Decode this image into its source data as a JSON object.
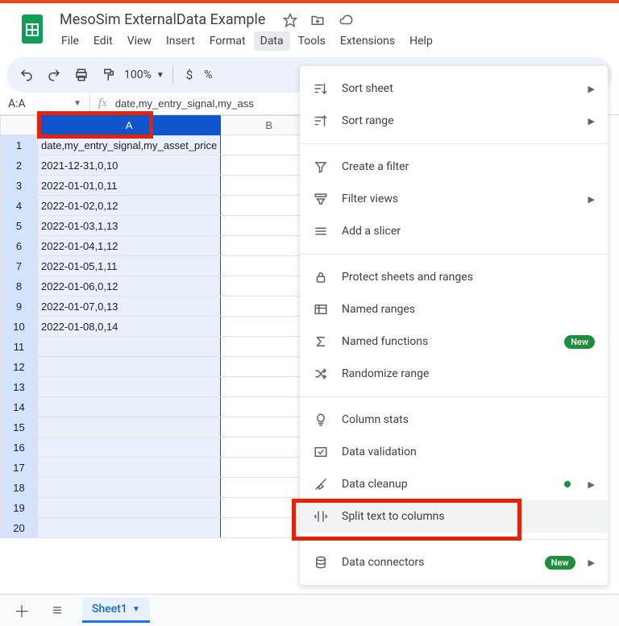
{
  "doc": {
    "title": "MesoSim ExternalData Example"
  },
  "menubar": [
    "File",
    "Edit",
    "View",
    "Insert",
    "Format",
    "Data",
    "Tools",
    "Extensions",
    "Help"
  ],
  "menubar_open_index": 5,
  "toolbar": {
    "zoom": "100%",
    "currency": "$",
    "percent": "%"
  },
  "namebox": "A:A",
  "formula_bar": "date,my_entry_signal,my_ass",
  "columns": [
    "A",
    "B",
    ""
  ],
  "selected_column_index": 0,
  "rows": [
    {
      "n": "1",
      "a": "date,my_entry_signal,my_asset_price"
    },
    {
      "n": "2",
      "a": "2021-12-31,0,10"
    },
    {
      "n": "3",
      "a": "2022-01-01,0,11"
    },
    {
      "n": "4",
      "a": "2022-01-02,0,12"
    },
    {
      "n": "5",
      "a": "2022-01-03,1,13"
    },
    {
      "n": "6",
      "a": "2022-01-04,1,12"
    },
    {
      "n": "7",
      "a": "2022-01-05,1,11"
    },
    {
      "n": "8",
      "a": "2022-01-06,0,12"
    },
    {
      "n": "9",
      "a": "2022-01-07,0,13"
    },
    {
      "n": "10",
      "a": "2022-01-08,0,14"
    },
    {
      "n": "11",
      "a": ""
    },
    {
      "n": "12",
      "a": ""
    },
    {
      "n": "13",
      "a": ""
    },
    {
      "n": "14",
      "a": ""
    },
    {
      "n": "15",
      "a": ""
    },
    {
      "n": "16",
      "a": ""
    },
    {
      "n": "17",
      "a": ""
    },
    {
      "n": "18",
      "a": ""
    },
    {
      "n": "19",
      "a": ""
    },
    {
      "n": "20",
      "a": ""
    }
  ],
  "data_menu": [
    {
      "type": "item",
      "icon": "sort-sheet",
      "label": "Sort sheet",
      "submenu": true
    },
    {
      "type": "item",
      "icon": "sort-range",
      "label": "Sort range",
      "submenu": true
    },
    {
      "type": "sep"
    },
    {
      "type": "item",
      "icon": "filter",
      "label": "Create a filter"
    },
    {
      "type": "item",
      "icon": "filter-views",
      "label": "Filter views",
      "submenu": true
    },
    {
      "type": "item",
      "icon": "slicer",
      "label": "Add a slicer"
    },
    {
      "type": "sep"
    },
    {
      "type": "item",
      "icon": "lock",
      "label": "Protect sheets and ranges"
    },
    {
      "type": "item",
      "icon": "named-ranges",
      "label": "Named ranges"
    },
    {
      "type": "item",
      "icon": "sigma",
      "label": "Named functions",
      "badge": "New"
    },
    {
      "type": "item",
      "icon": "shuffle",
      "label": "Randomize range"
    },
    {
      "type": "sep"
    },
    {
      "type": "item",
      "icon": "bulb",
      "label": "Column stats"
    },
    {
      "type": "item",
      "icon": "validation",
      "label": "Data validation"
    },
    {
      "type": "item",
      "icon": "cleanup",
      "label": "Data cleanup",
      "submenu": true,
      "dot": true
    },
    {
      "type": "item",
      "icon": "split",
      "label": "Split text to columns",
      "hover": true
    },
    {
      "type": "sep"
    },
    {
      "type": "item",
      "icon": "connectors",
      "label": "Data connectors",
      "badge": "New",
      "submenu": true
    }
  ],
  "sheet_tab": "Sheet1"
}
